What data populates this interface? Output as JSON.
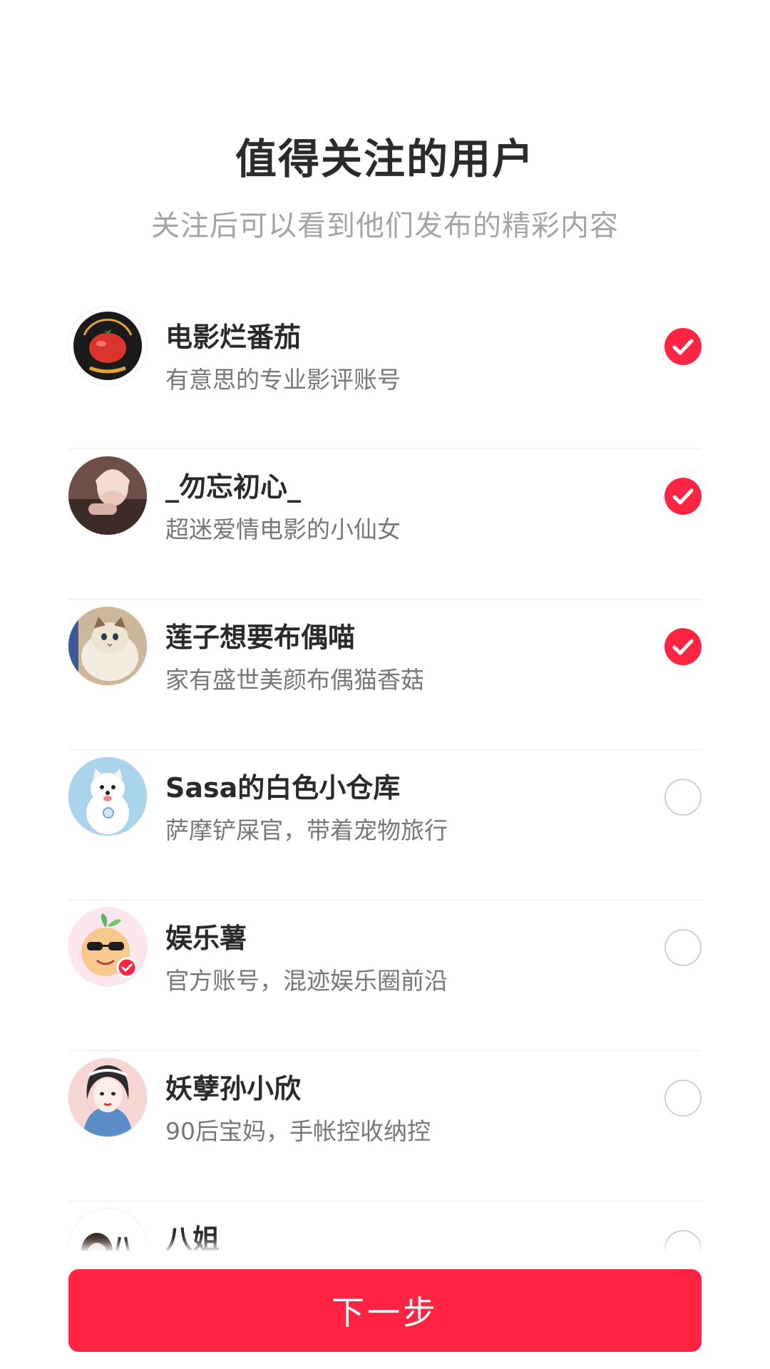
{
  "header": {
    "title": "值得关注的用户",
    "subtitle": "关注后可以看到他们发布的精彩内容"
  },
  "users": [
    {
      "name": "电影烂番茄",
      "description": "有意思的专业影评账号",
      "selected": true,
      "avatar": "rotten-tomatoes-logo"
    },
    {
      "name": "_勿忘初心_",
      "description": "超迷爱情电影的小仙女",
      "selected": true,
      "avatar": "girl-photo"
    },
    {
      "name": "莲子想要布偶喵",
      "description": "家有盛世美颜布偶猫香菇",
      "selected": true,
      "avatar": "ragdoll-cat-photo"
    },
    {
      "name": "Sasa的白色小仓库",
      "description": "萨摩铲屎官，带着宠物旅行",
      "selected": false,
      "avatar": "samoyed-dog-photo"
    },
    {
      "name": "娱乐薯",
      "description": "官方账号，混迹娱乐圈前沿",
      "selected": false,
      "avatar": "potato-mascot-verified"
    },
    {
      "name": "妖孽孙小欣",
      "description": "90后宝妈，手帐控收纳控",
      "selected": false,
      "avatar": "girl-illustration"
    },
    {
      "name": "八姐",
      "description": "",
      "selected": false,
      "avatar": "cartoon-avatar"
    }
  ],
  "footer": {
    "next_label": "下一步"
  },
  "colors": {
    "accent": "#ff2442",
    "title": "#2b2b2b",
    "subtitle": "#a4a4a4",
    "description": "#777777",
    "divider": "#ebebeb"
  }
}
